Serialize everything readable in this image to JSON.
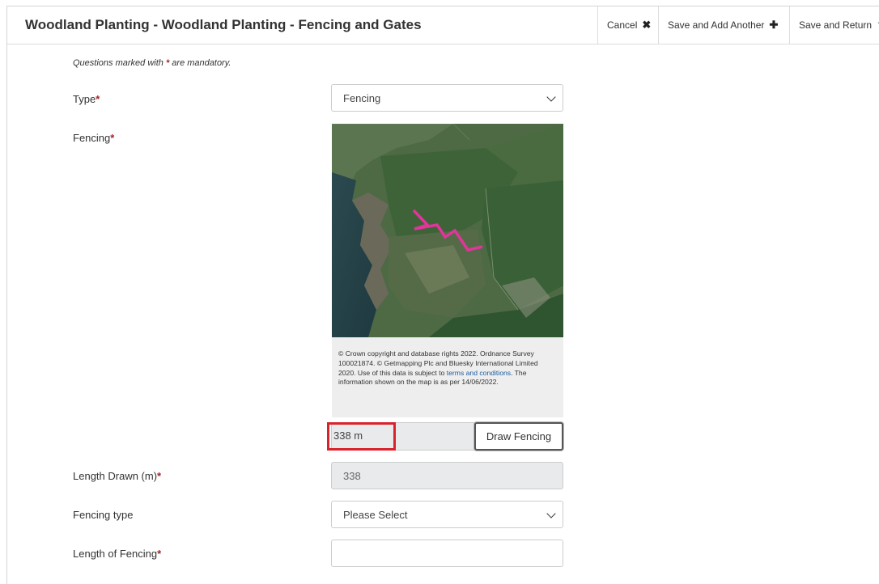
{
  "header": {
    "title": "Woodland Planting - Woodland Planting - Fencing and Gates",
    "cancel_label": "Cancel",
    "save_add_label": "Save and Add Another",
    "save_return_label": "Save and Return"
  },
  "form": {
    "mandatory_note": "Questions marked with",
    "mandatory_note_suffix": "are mandatory.",
    "asterisk": "*",
    "type_label": "Type",
    "type_value": "Fencing",
    "fencing_label": "Fencing",
    "map_attribution_pre": "© Crown copyright and database rights 2022. Ordnance Survey 100021874. © Getmapping Plc and Bluesky International Limited 2020. Use of this data is subject to",
    "map_attribution_link": "terms and conditions",
    "map_attribution_post": ". The information shown on the map is as per 14/06/2022.",
    "measured_length": "338 m",
    "draw_button_label": "Draw Fencing",
    "length_drawn_label": "Length Drawn (m)",
    "length_drawn_value": "338",
    "fencing_type_label": "Fencing type",
    "fencing_type_value": "Please Select",
    "length_of_fencing_label": "Length of Fencing",
    "length_of_fencing_value": ""
  },
  "colors": {
    "required": "#a4232a",
    "highlight": "#d9222a",
    "fence_line": "#e0359a"
  },
  "icons": {
    "cancel": "times-icon",
    "add": "plus-icon",
    "save_return": "upload-icon"
  }
}
